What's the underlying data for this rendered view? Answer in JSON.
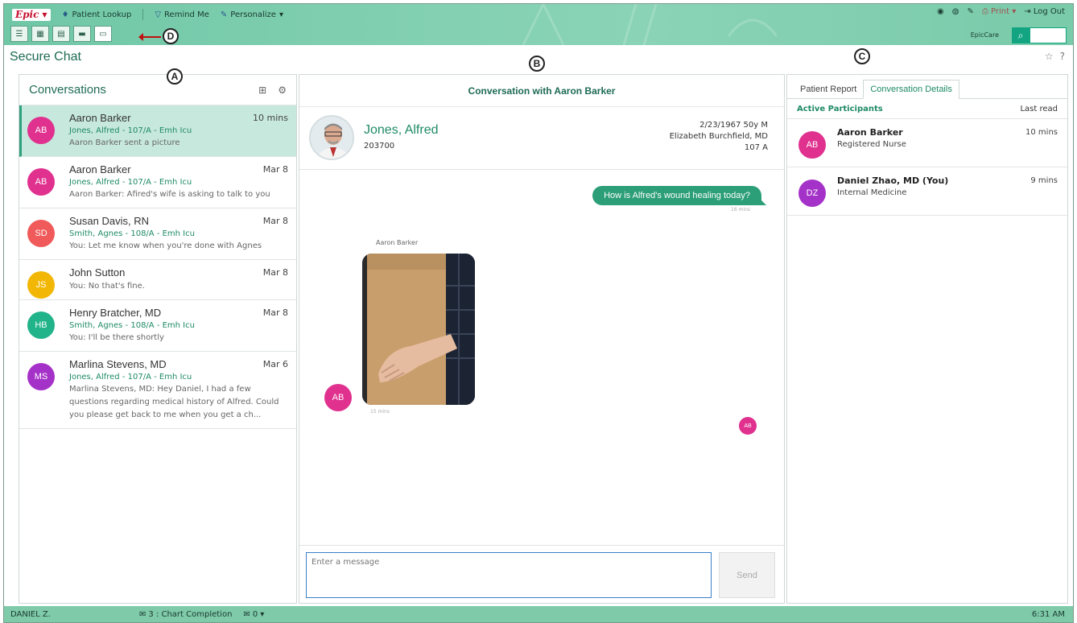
{
  "app": {
    "logo": "Epic",
    "menu": [
      "Patient Lookup",
      "Remind Me",
      "Personalize"
    ],
    "right_menu": {
      "print": "Print",
      "logout": "Log Out"
    },
    "context": "EpicCare",
    "search_value": ""
  },
  "callouts": {
    "a": "A",
    "b": "B",
    "c": "C",
    "d": "D"
  },
  "page": {
    "title": "Secure Chat"
  },
  "conversations": {
    "title": "Conversations",
    "items": [
      {
        "initials": "AB",
        "color": "#e0318f",
        "name": "Aaron Barker",
        "time": "10 mins",
        "patient": "Jones, Alfred - 107/A - Emh Icu",
        "preview": "Aaron Barker sent a picture"
      },
      {
        "initials": "AB",
        "color": "#e0318f",
        "name": "Aaron Barker",
        "time": "Mar 8",
        "patient": "Jones, Alfred - 107/A - Emh Icu",
        "preview": "Aaron Barker: Afired's wife is asking to talk to you"
      },
      {
        "initials": "SD",
        "color": "#f05a5a",
        "name": "Susan Davis, RN",
        "time": "Mar 8",
        "patient": "Smith, Agnes - 108/A - Emh Icu",
        "preview": "You: Let me know when you're done with Agnes"
      },
      {
        "initials": "JS",
        "color": "#f2b705",
        "name": "John Sutton",
        "time": "Mar 8",
        "patient": "",
        "preview": "You: No that's fine."
      },
      {
        "initials": "HB",
        "color": "#21b38a",
        "name": "Henry Bratcher, MD",
        "time": "Mar 8",
        "patient": "Smith, Agnes - 108/A - Emh Icu",
        "preview": "You: I'll be there shortly"
      },
      {
        "initials": "MS",
        "color": "#a532c8",
        "name": "Marlina Stevens, MD",
        "time": "Mar 6",
        "patient": "Jones, Alfred - 107/A - Emh Icu",
        "preview": "Marlina Stevens, MD: Hey Daniel, I had a few questions regarding medical history of Alfred. Could you please get back to me when you get a ch..."
      }
    ]
  },
  "conversation": {
    "title": "Conversation with Aaron Barker",
    "patient": {
      "name": "Jones, Alfred",
      "mrn": "203700",
      "dob_age_sex": "2/23/1967 50y M",
      "provider": "Elizabeth Burchfield, MD",
      "room": "107 A"
    },
    "messages": {
      "outgoing_text": "How is Alfred's wound healing today?",
      "outgoing_time": "16 mins",
      "incoming_sender": "Aaron Barker",
      "incoming_initials": "AB",
      "incoming_time": "15 mins",
      "read_initials": "AB"
    },
    "composer": {
      "placeholder": "Enter a message",
      "send_label": "Send"
    }
  },
  "details": {
    "tabs": [
      "Patient Report",
      "Conversation Details"
    ],
    "active_tab": 1,
    "section_title": "Active Participants",
    "last_read_label": "Last read",
    "participants": [
      {
        "initials": "AB",
        "color": "#e0318f",
        "name": "Aaron Barker",
        "role": "Registered Nurse",
        "time": "10 mins"
      },
      {
        "initials": "DZ",
        "color": "#a532c8",
        "name": "Daniel Zhao, MD (You)",
        "role": "Internal Medicine",
        "time": "9 mins"
      }
    ]
  },
  "status": {
    "user": "DANIEL Z.",
    "chart_completion": "3 : Chart Completion",
    "messages": "0",
    "time": "6:31 AM"
  }
}
